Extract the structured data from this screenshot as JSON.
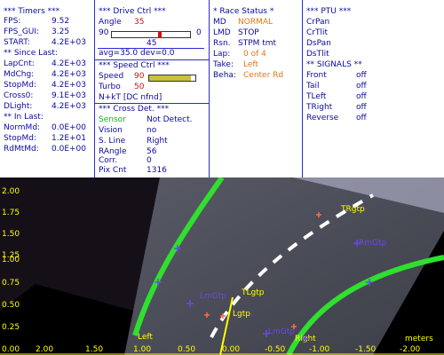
{
  "timers": {
    "header": "*** Timers ***",
    "fps_label": "FPS:",
    "fps_value": "9.52",
    "fps_gui_label": "FPS_GUI:",
    "fps_gui_value": "3.25",
    "start_label": "START:",
    "start_value": "4.2E+03",
    "since_header": "** Since Last:",
    "lapcnt_label": "LapCnt:",
    "lapcnt_value": "4.2E+03",
    "mdchg_label": "MdChg:",
    "mdchg_value": "4.2E+03",
    "stopmd_label": "StopMd:",
    "stopmd_value": "4.2E+03",
    "cross0_label": "Cross0:",
    "cross0_value": "9.1E+03",
    "dlight_label": "DLight:",
    "dlight_value": "4.2E+03",
    "in_last_header": "** In Last:",
    "normmd_label": "NormMd:",
    "normmd_value": "0.0E+00",
    "stopmd2_label": "StopMd:",
    "stopmd2_value": "1.2E+01",
    "rdmtmd_label": "RdMtMd:",
    "rdmtmd_value": "0.0E+00"
  },
  "drive": {
    "header": "***  Drive Ctrl  ***",
    "angle_label": "Angle",
    "angle_value": "35",
    "scale_left": "90",
    "scale_right": "0",
    "scale_mid": "45",
    "avg_text": "avg=35.0  dev=0.0",
    "angle_fraction": 0.61
  },
  "speed": {
    "header": "***  Speed Ctrl  ***",
    "speed_label": "Speed",
    "speed_value": "90",
    "turbo_label": "Turbo",
    "turbo_value": "50",
    "note": "N+kT [DC nfnd]",
    "speed_fraction": 0.9
  },
  "cross": {
    "header": "*** Cross Det. ***",
    "sensor_label": "Sensor",
    "sensor_value": "Not Detect.",
    "vision_label": "Vision",
    "vision_value": "no",
    "sline_label": "S. Line",
    "sline_value": "Right",
    "rangle_label": "RAngle",
    "rangle_value": "56",
    "corr_label": "Corr.",
    "corr_value": "0",
    "pix_label": "Pix Cnt",
    "pix_value": "1316"
  },
  "race": {
    "header": "* Race Status *",
    "md_label": "MD",
    "md_value": "NORMAL",
    "lmd_label": "LMD",
    "lmd_value": "STOP",
    "rsn_label": "Rsn.",
    "rsn_value": "STPM tmt",
    "lap_label": "Lap:",
    "lap_value": "0 of 4",
    "take_label": "Take:",
    "take_value": "Left",
    "beha_label": "Beha:",
    "beha_value": "Center Rd"
  },
  "ptu": {
    "header": "*** PTU ***",
    "items": [
      "CrPan",
      "CrTlit",
      "DsPan",
      "DsTlit"
    ]
  },
  "signals": {
    "header": "** SIGNALS **",
    "items": [
      {
        "label": "Front",
        "value": "off"
      },
      {
        "label": "Tail",
        "value": "off"
      },
      {
        "label": "TLeft",
        "value": "off"
      },
      {
        "label": "TRight",
        "value": "off"
      },
      {
        "label": "Reverse",
        "value": "off"
      }
    ]
  },
  "camera": {
    "y_ticks": [
      "2.00",
      "1.75",
      "1.50",
      "1.25",
      "1.00",
      "0.75",
      "0.50",
      "0.25",
      "0.00"
    ],
    "x_ticks": [
      "2.00",
      "1.50",
      "1.00",
      "0.50",
      "0.00",
      "-0.50",
      "-1.00",
      "-1.50",
      "-2.00"
    ],
    "units": "meters",
    "labels": {
      "left": "Left",
      "right": "Right",
      "tlgtp": "TLgtp",
      "lgtp": "Lgtp",
      "trgtp": "TRgtp",
      "lmgtp": "LmGtp",
      "rmgtp": "RmGtp",
      "lmgtp2": "LmGtp",
      "rmgtp2": "RmGtp"
    },
    "colors": {
      "lane": "#2fe02f",
      "marker": "#6a4ae8",
      "yellow": "#ffff00",
      "orange_cross": "#ff6a40"
    }
  }
}
